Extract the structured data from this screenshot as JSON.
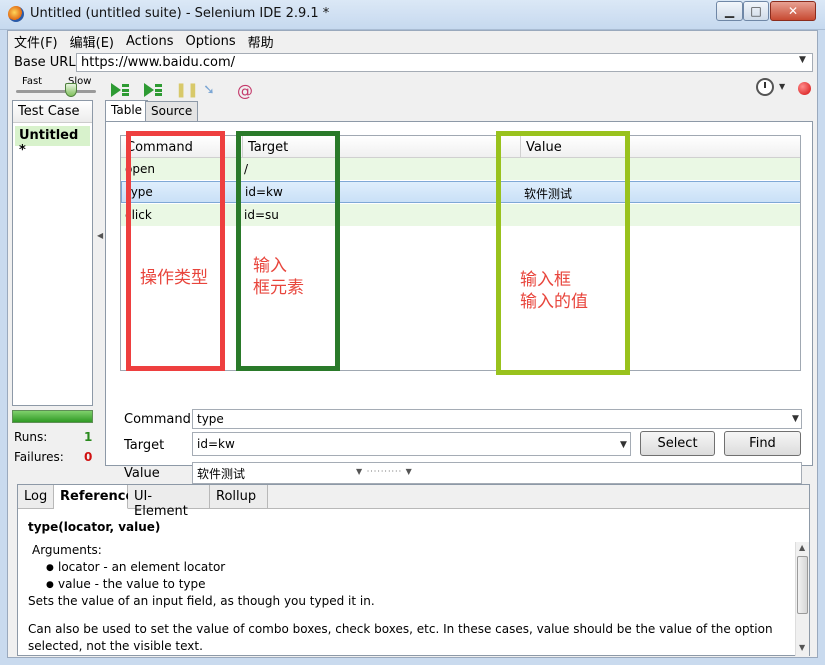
{
  "window": {
    "title": "Untitled (untitled suite) - Selenium IDE 2.9.1 *",
    "minimize": "▁",
    "maximize": "□",
    "close": "✕"
  },
  "menu": [
    "文件(F)",
    "编辑(E)",
    "Actions",
    "Options",
    "帮助"
  ],
  "base_url": {
    "label": "Base URL",
    "value": "https://www.baidu.com/"
  },
  "toolbar": {
    "speed_fast": "Fast",
    "speed_slow": "Slow",
    "speed_level": 0.7
  },
  "test_case_panel": {
    "header": "Test Case",
    "items": [
      "Untitled *"
    ]
  },
  "stats": {
    "runs_label": "Runs:",
    "runs": "1",
    "failures_label": "Failures:",
    "failures": "0"
  },
  "tabs": [
    "Table",
    "Source"
  ],
  "grid": {
    "columns": [
      "Command",
      "Target",
      "Value"
    ],
    "rows": [
      {
        "command": "open",
        "target": "/",
        "value": ""
      },
      {
        "command": "type",
        "target": "id=kw",
        "value": "软件测试"
      },
      {
        "command": "click",
        "target": "id=su",
        "value": ""
      }
    ],
    "selected_row": 1
  },
  "annotations": {
    "command": "操作类型",
    "target": "输入\n框元素",
    "value": "输入框\n输入的值"
  },
  "editor": {
    "command_label": "Command",
    "command_value": "type",
    "target_label": "Target",
    "target_value": "id=kw",
    "value_label": "Value",
    "value_value": "软件测试",
    "select_button": "Select",
    "find_button": "Find"
  },
  "bottom_tabs": [
    "Log",
    "Reference",
    "UI-Element",
    "Rollup"
  ],
  "reference": {
    "title": "type(locator, value)",
    "args_label": "Arguments:",
    "args": [
      "locator - an element locator",
      "value - the value to type"
    ],
    "desc": "Sets the value of an input field, as though you typed it in.",
    "desc2": "Can also be used to set the value of combo boxes, check boxes, etc. In these cases, value should be the value of the option selected, not the visible text."
  },
  "colors": {
    "annotation_command": "#ee3f3f",
    "annotation_target": "#2a7a2a",
    "annotation_value": "#99c21d",
    "annotation_text": "#e8453c"
  }
}
